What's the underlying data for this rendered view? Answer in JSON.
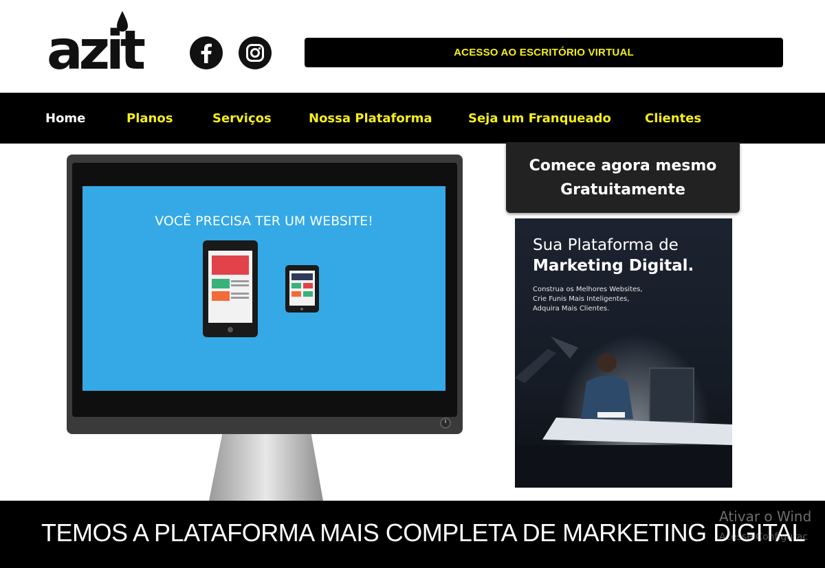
{
  "header": {
    "logo_text": "azit",
    "virtual_office_label": "ACESSO AO ESCRITÓRIO VIRTUAL",
    "social": [
      "facebook-icon",
      "instagram-icon"
    ]
  },
  "nav": {
    "items": [
      {
        "label": "Home",
        "active": true
      },
      {
        "label": "Planos"
      },
      {
        "label": "Serviços"
      },
      {
        "label": "Nossa Plataforma"
      },
      {
        "label": "Seja um Franqueado"
      },
      {
        "label": "Clientes"
      }
    ]
  },
  "monitor": {
    "screen_text": "VOCÊ PRECISA TER UM WEBSITE!"
  },
  "cta": {
    "line1": "Comece agora mesmo",
    "line2": "Gratuitamente"
  },
  "promo": {
    "title_line1": "Sua Plataforma de",
    "title_line2": "Marketing Digital.",
    "sub_line1": "Construa os Melhores Websites,",
    "sub_line2": "Crie Funis Mais Inteligentes,",
    "sub_line3": "Adquira Mais Clientes."
  },
  "banner": {
    "text": "TEMOS A PLATAFORMA MAIS COMPLETA DE MARKETING DIGITAL"
  },
  "watermark": {
    "line1": "Ativar o Wind",
    "line2": "Acesse Configurac"
  },
  "colors": {
    "accent": "#f5ef1a",
    "black": "#000000",
    "screen_blue": "#34a9e6"
  }
}
